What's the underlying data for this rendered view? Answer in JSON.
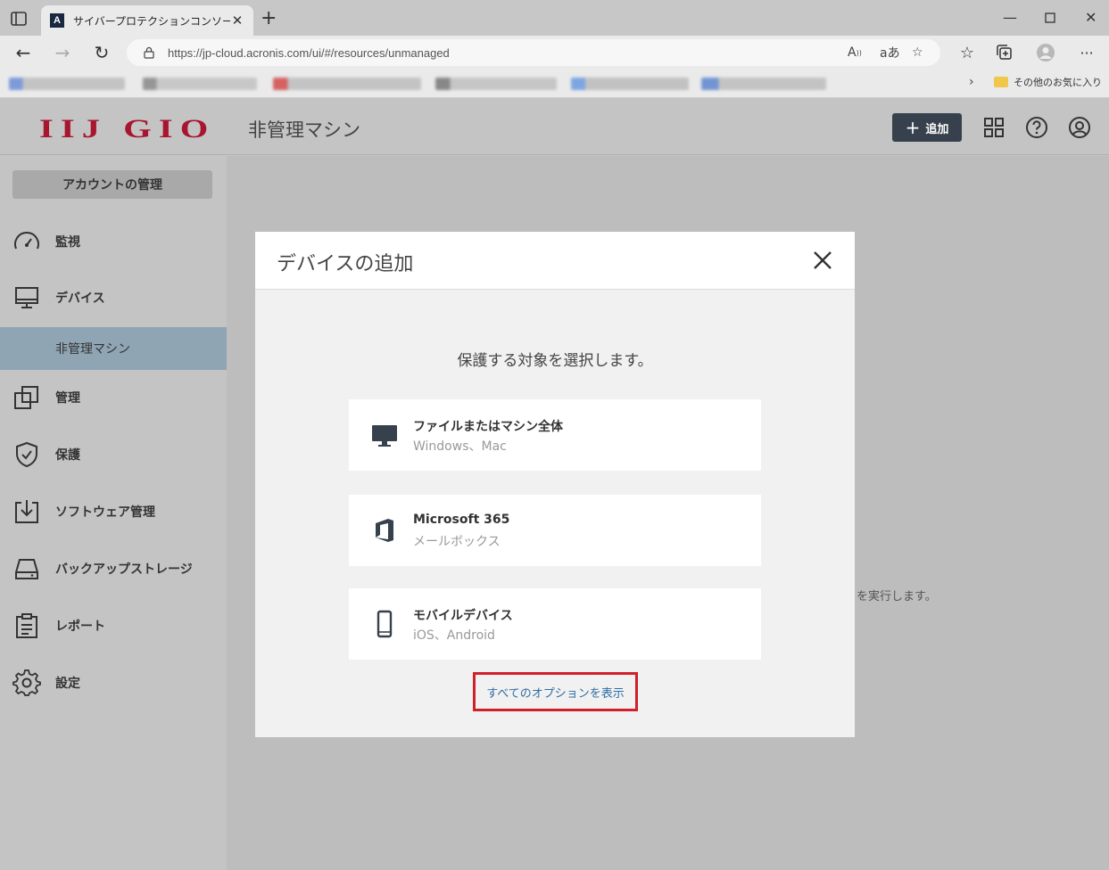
{
  "browser": {
    "tab_title": "サイバープロテクションコンソール",
    "tab_favicon": "A",
    "url": "https://jp-cloud.acronis.com/ui/#/resources/unmanaged",
    "other_favorites": "その他のお気に入り"
  },
  "app": {
    "logo": "IIJ GIO",
    "page_title": "非管理マシン",
    "add_button": "追加",
    "account_button": "アカウントの管理",
    "nav": [
      {
        "label": "監視",
        "icon": "dashboard-gauge-icon"
      },
      {
        "label": "デバイス",
        "icon": "monitor-icon"
      },
      {
        "label": "非管理マシン",
        "icon": ""
      },
      {
        "label": "管理",
        "icon": "copy-squares-icon"
      },
      {
        "label": "保護",
        "icon": "shield-icon"
      },
      {
        "label": "ソフトウェア管理",
        "icon": "download-box-icon"
      },
      {
        "label": "バックアップストレージ",
        "icon": "drive-icon"
      },
      {
        "label": "レポート",
        "icon": "clipboard-icon"
      },
      {
        "label": "設定",
        "icon": "gear-icon"
      }
    ],
    "background_text": "を実行します。"
  },
  "modal": {
    "title": "デバイスの追加",
    "subtitle": "保護する対象を選択します。",
    "options": [
      {
        "title": "ファイルまたはマシン全体",
        "subtitle": "Windows、Mac",
        "icon": "desktop-icon"
      },
      {
        "title": "Microsoft 365",
        "subtitle": "メールボックス",
        "icon": "office-icon"
      },
      {
        "title": "モバイルデバイス",
        "subtitle": "iOS、Android",
        "icon": "smartphone-icon"
      }
    ],
    "show_all_link": "すべてのオプションを表示"
  },
  "colors": {
    "logo": "#a8152f",
    "add_button_bg": "#37414d",
    "active_nav_bg": "#8fa5b3",
    "highlight_border": "#d0202a",
    "link": "#2e6da4"
  }
}
